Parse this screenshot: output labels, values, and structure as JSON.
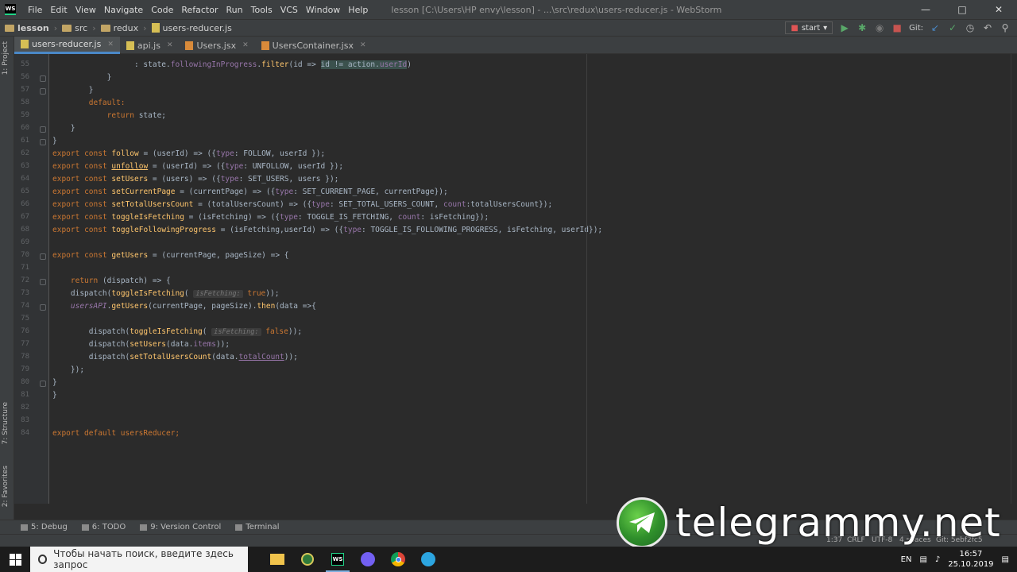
{
  "app": {
    "menu": [
      "File",
      "Edit",
      "View",
      "Navigate",
      "Code",
      "Refactor",
      "Run",
      "Tools",
      "VCS",
      "Window",
      "Help"
    ],
    "title": "lesson [C:\\Users\\HP envy\\lesson] - ...\\src\\redux\\users-reducer.js - WebStorm"
  },
  "breadcrumbs": [
    "lesson",
    "src",
    "redux",
    "users-reducer.js"
  ],
  "run": {
    "config": "start",
    "git_label": "Git:"
  },
  "tabs": [
    {
      "label": "users-reducer.js",
      "active": true
    },
    {
      "label": "api.js",
      "active": false
    },
    {
      "label": "Users.jsx",
      "active": false
    },
    {
      "label": "UsersContainer.jsx",
      "active": false
    }
  ],
  "side_tabs": {
    "project": "1: Project",
    "structure": "7: Structure",
    "favorites": "2: Favorites"
  },
  "line_numbers": [
    "55",
    "56",
    "57",
    "58",
    "59",
    "60",
    "61",
    "62",
    "63",
    "64",
    "65",
    "66",
    "67",
    "68",
    "69",
    "70",
    "71",
    "72",
    "73",
    "74",
    "75",
    "76",
    "77",
    "78",
    "79",
    "80",
    "81",
    "82",
    "83",
    "84"
  ],
  "code": {
    "l55_sep": ": ",
    "l55_a": "state.",
    "l55_b": "followingInProgress",
    "l55_c": ".",
    "l55_d": "filter",
    "l55_e": "(id => ",
    "l55_f": "id != action.",
    "l55_g": "userId",
    "l55_h": ")",
    "brace_close": "}",
    "default_kw": "default:",
    "return_kw": "return",
    "return_state": " state;",
    "close_paren": "})",
    "export": "export",
    "const": "const",
    "follow_name": "follow",
    "follow_rest": " = (userId) => ({",
    "follow_type": "type",
    "follow_tail": ": FOLLOW, userId });",
    "unfollow_name": "unfollow",
    "unfollow_rest": " = (userId) => ({",
    "unfollow_tail": ": UNFOLLOW, userId });",
    "setUsers_name": "setUsers",
    "setUsers_rest": " = (users) => ({",
    "setUsers_tail": ": SET_USERS, users });",
    "setCurrentPage_name": "setCurrentPage",
    "setCurrentPage_rest": " = (currentPage) => ({",
    "setCurrentPage_tail": ": SET_CURRENT_PAGE, currentPage});",
    "setTotal_name": "setTotalUsersCount",
    "setTotal_rest": " = (totalUsersCount) => ({",
    "setTotal_mid": ": SET_TOTAL_USERS_COUNT, ",
    "count": "count",
    "setTotal_tail": ":totalUsersCount});",
    "toggleFetch_name": "toggleIsFetching",
    "toggleFetch_rest": " = (isFetching) => ({",
    "toggleFetch_mid": ": TOGGLE_IS_FETCHING, ",
    "toggleFetch_tail": ": isFetching});",
    "toggleProg_name": "toggleFollowingProgress",
    "toggleProg_rest": " = (isFetching,userId) => ({",
    "toggleProg_tail": ": TOGGLE_IS_FOLLOWING_PROGRESS, isFetching, userId});",
    "getUsers_name": "getUsers",
    "getUsers_rest": " = (currentPage, pageSize) => {",
    "ret_dispatch": " (dispatch) => {",
    "dispatch_open": "dispatch(",
    "toggle_call": "toggleIsFetching",
    "paren_open": "(",
    "hint_isFetching": "isFetching:",
    "true_val": "true",
    "false_val": "false",
    "close_2": "));",
    "usersAPI": "usersAPI",
    "dot": ".",
    "getUsers_call": "getUsers",
    "getUsers_args": "(currentPage, pageSize).",
    "then": "then",
    "then_args": "(data =>{",
    "setUsers_call": "setUsers",
    "data_items_a": "(data.",
    "items": "items",
    "close_3": "));",
    "setTotal_call": "setTotalUsersCount",
    "data_total_a": "(data.",
    "totalCount": "totalCount",
    "close_then": "});",
    "default_export": " default usersReducer;"
  },
  "bottom_tools": [
    "5: Debug",
    "6: TODO",
    "9: Version Control",
    "Terminal"
  ],
  "status": {
    "position": "1:37",
    "line_sep": "CRLF",
    "encoding": "UTF-8",
    "indent": "4 spaces",
    "git": "Git: 5ebf2fc5"
  },
  "watermark": "telegrammy.net",
  "taskbar": {
    "search_placeholder": "Чтобы начать поиск, введите здесь запрос",
    "lang": "EN",
    "time": "16:57",
    "date": "25.10.2019"
  }
}
